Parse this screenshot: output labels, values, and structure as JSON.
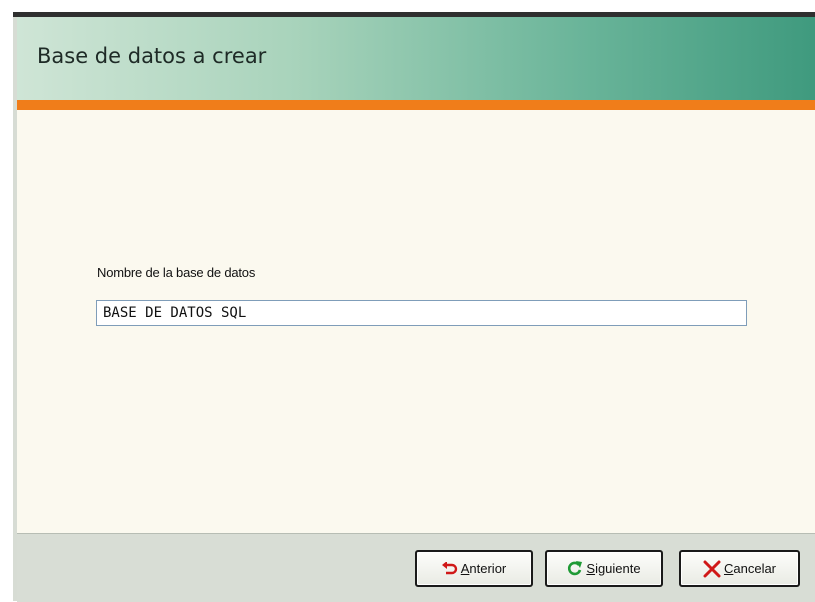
{
  "header": {
    "title": "Base de datos a crear"
  },
  "form": {
    "label": "Nombre de la base de datos",
    "value": "BASE DE DATOS SQL"
  },
  "buttons": {
    "previous": {
      "first": "A",
      "rest": "nterior",
      "icon": "undo-arrow-icon"
    },
    "next": {
      "first": "S",
      "rest": "iguiente",
      "icon": "refresh-arrow-icon"
    },
    "cancel": {
      "first": "C",
      "rest": "ancelar",
      "icon": "close-x-icon"
    }
  },
  "colors": {
    "accent": "#f07d1a",
    "header_start": "#cfe5d6",
    "header_end": "#3f9a7e",
    "content_bg": "#fbf9ef"
  }
}
